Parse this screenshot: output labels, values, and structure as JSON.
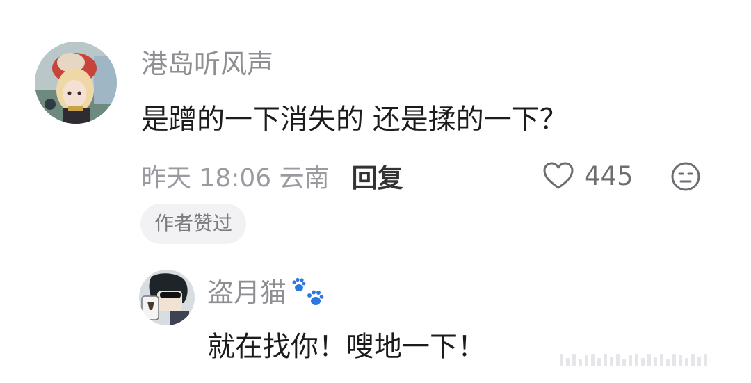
{
  "comment": {
    "username": "港岛听风声",
    "text": "是蹭的一下消失的 还是揉的一下？",
    "timestamp": "昨天 18:06 云南",
    "reply_label": "回复",
    "like_count": "445",
    "author_badge": "作者赞过",
    "icons": {
      "like": "heart-outline-icon",
      "dislike": "meh-face-icon"
    }
  },
  "reply": {
    "username": "盗月猫",
    "username_emoji": "paw-prints-icon",
    "text": "就在找你！嗖地一下！"
  },
  "colors": {
    "username": "#8e8e93",
    "text": "#1c1c1e",
    "meta": "#9a9aa0",
    "badge_bg": "#f2f2f4",
    "paw": "#2b78e4"
  }
}
